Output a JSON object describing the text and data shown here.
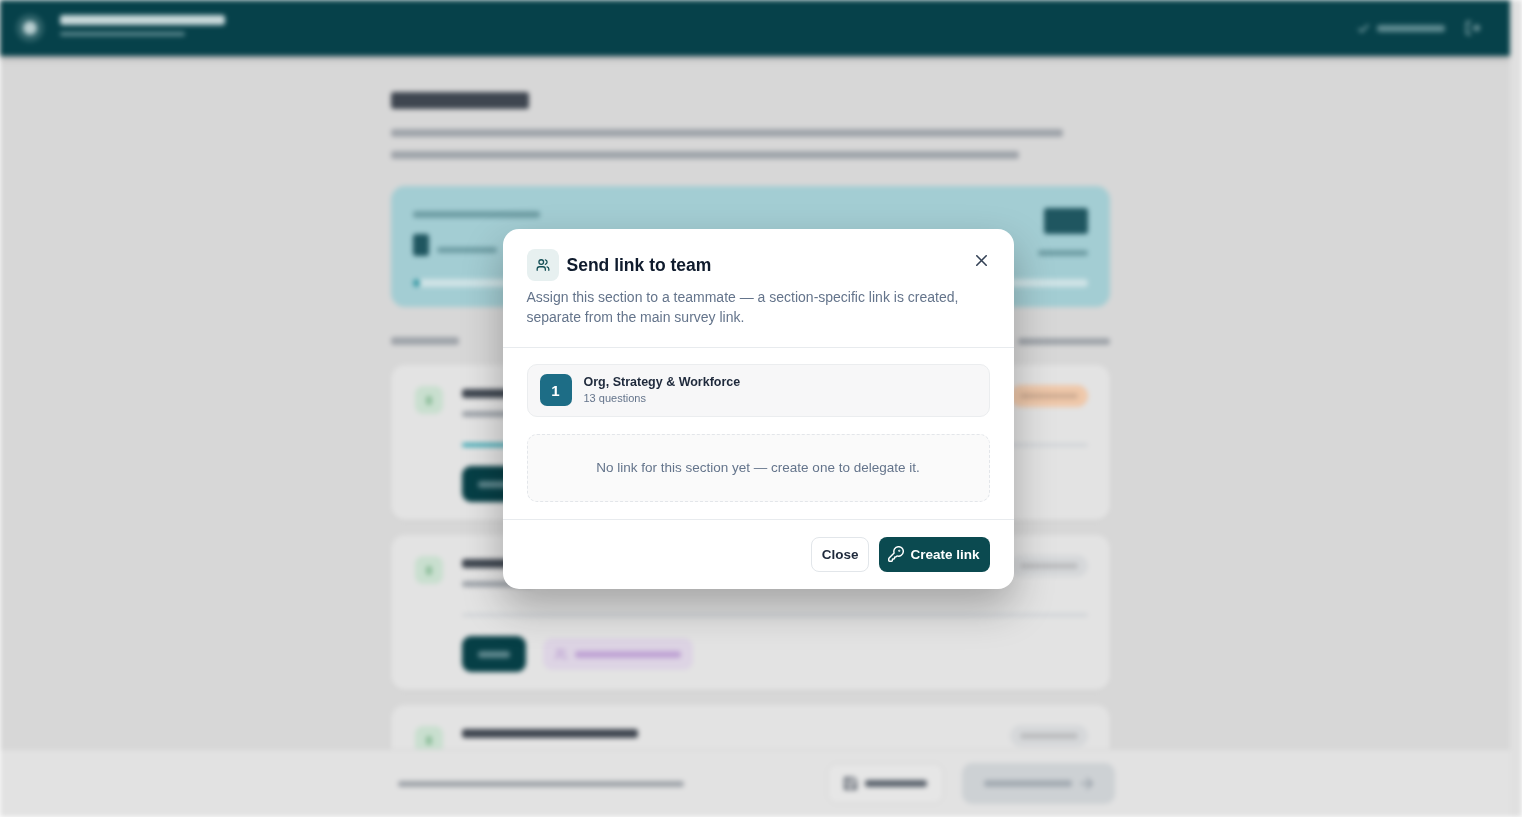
{
  "background_page": {
    "progress": {
      "level": 0.01
    },
    "sections": [
      {
        "color": "#efc8aa",
        "level": 0.15,
        "actions": [
          {
            "kind": "primary"
          }
        ]
      },
      {
        "color": "#d6d8da",
        "actions": [
          {
            "kind": "primary"
          },
          {
            "kind": "delegate"
          }
        ]
      },
      {
        "color": "#d6d8da"
      }
    ],
    "footer": {
      "buttons": [
        {
          "kind": "secondary",
          "disabled": false
        },
        {
          "kind": "primary",
          "disabled": true
        }
      ]
    }
  },
  "dialog": {
    "title": "Send link to team",
    "description": "Assign this section to a teammate — a section-specific link is created, separate from the main survey link.",
    "section": {
      "number": "1",
      "title": "Org, Strategy & Workforce",
      "count": "13 questions"
    },
    "empty_message": "No link for this section yet — create one to delegate it.",
    "buttons": [
      {
        "kind": "secondary",
        "label": "Close"
      },
      {
        "kind": "primary",
        "label": "Create link"
      }
    ]
  }
}
